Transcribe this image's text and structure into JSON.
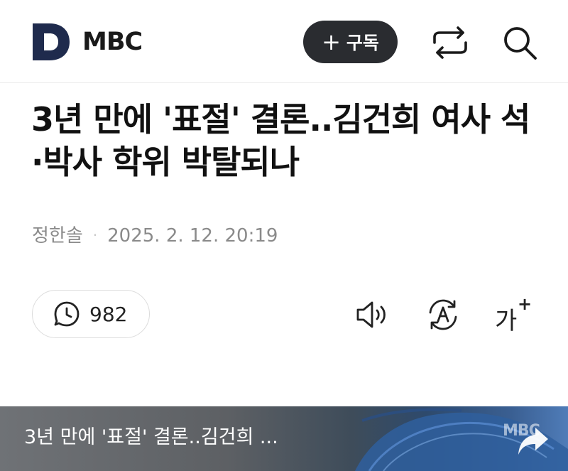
{
  "header": {
    "brand": "MBC",
    "logo_letter": "D",
    "subscribe_plus": "+",
    "subscribe_label": "구독",
    "icons": [
      "share-icon",
      "search-icon"
    ]
  },
  "article": {
    "headline": "3년 만에 '표절' 결론..김건희 여사 석·박사 학위 박탈되나",
    "author": "정한솔",
    "separator": "·",
    "date": "2025. 2. 12. 20:19"
  },
  "actions": {
    "views": "982",
    "fontsize_glyph": "가",
    "fontsize_plus": "+",
    "icons": [
      "clock-chat-icon",
      "speaker-icon",
      "translate-icon",
      "font-size-icon"
    ]
  },
  "video": {
    "title": "3년 만에 '표절' 결론..김건희 ...",
    "watermark": "MBC"
  },
  "colors": {
    "logo_navy": "#1f2b4d",
    "subscribe_bg": "#2a2c30",
    "text_primary": "#111111",
    "text_meta": "#8a8a8a"
  }
}
